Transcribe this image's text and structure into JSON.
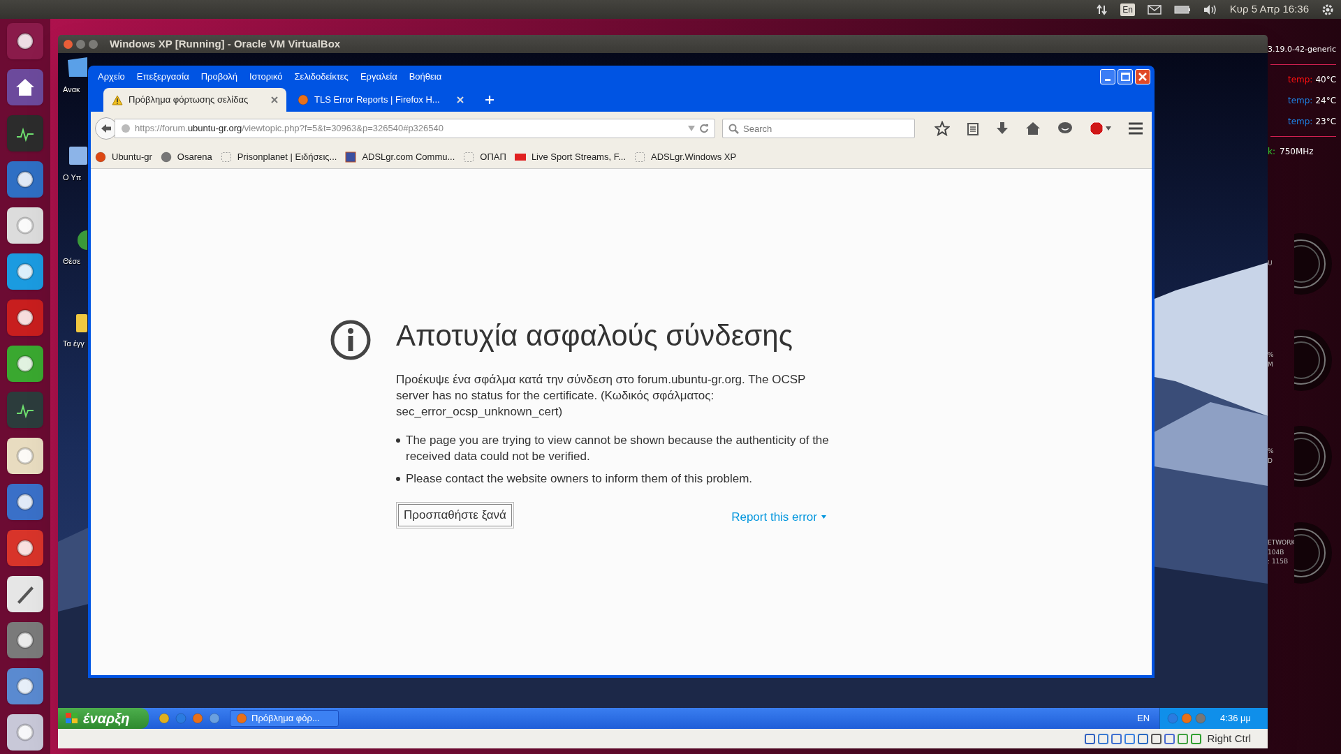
{
  "top_panel": {
    "keyboard": "En",
    "clock": "Κυρ 5 Απρ 16:36"
  },
  "launcher": [
    {
      "kind": "dash"
    },
    {
      "kind": "home"
    },
    {
      "kind": "terminal"
    },
    {
      "kind": "firefox"
    },
    {
      "kind": "chrome"
    },
    {
      "kind": "skype"
    },
    {
      "kind": "reader"
    },
    {
      "kind": "gear"
    },
    {
      "kind": "monitor"
    },
    {
      "kind": "popcorn"
    },
    {
      "kind": "globe"
    },
    {
      "kind": "store"
    },
    {
      "kind": "editor"
    },
    {
      "kind": "installer"
    },
    {
      "kind": "cube"
    },
    {
      "kind": "workspace"
    }
  ],
  "vbox": {
    "title": "Windows XP [Running] - Oracle VM VirtualBox",
    "host_key": "Right Ctrl"
  },
  "desktop_icons": [
    {
      "kind": "bin",
      "label": "Ανακ"
    },
    {
      "kind": "computer",
      "label": "Ο Υπ"
    },
    {
      "kind": "globe",
      "label": "Θέσε"
    },
    {
      "kind": "folder",
      "label": "Τα έγγ"
    }
  ],
  "firefox": {
    "menu": [
      "Αρχείο",
      "Επεξεργασία",
      "Προβολή",
      "Ιστορικό",
      "Σελιδοδείκτες",
      "Εργαλεία",
      "Βοήθεια"
    ],
    "tabs": [
      {
        "kind": "warning",
        "label": "Πρόβλημα φόρτωσης σελίδας",
        "selected": true
      },
      {
        "kind": "firefox",
        "label": "TLS Error Reports | Firefox H...",
        "selected": false
      }
    ],
    "url": {
      "scheme": "https://forum.",
      "domain": "ubuntu-gr.org",
      "path": "/viewtopic.php?f=5&t=30963&p=326540#p326540"
    },
    "search": {
      "placeholder": "Search"
    },
    "bookmarks": [
      {
        "kind": "ubuntu",
        "label": "Ubuntu-gr"
      },
      {
        "kind": "swirl",
        "label": "Osarena"
      },
      {
        "kind": "blank",
        "label": "Prisonplanet | Ειδήσεις..."
      },
      {
        "kind": "grid",
        "label": "ADSLgr.com Commu..."
      },
      {
        "kind": "blank",
        "label": "ΟΠΑΠ"
      },
      {
        "kind": "live",
        "label": "Live Sport Streams, F..."
      },
      {
        "kind": "blank",
        "label": "ADSLgr.Windows XP"
      }
    ],
    "error": {
      "title": "Αποτυχία ασφαλούς σύνδεσης",
      "description": "Προέκυψε ένα σφάλμα κατά την σύνδεση στο forum.ubuntu-gr.org. The OCSP server has no status for the certificate. (Κωδικός σφάλματος: sec_error_ocsp_unknown_cert)",
      "bullets": [
        "The page you are trying to view cannot be shown because the authenticity of the received data could not be verified.",
        "Please contact the website owners to inform them of this problem."
      ],
      "button": "Προσπαθήστε ξανά",
      "report": "Report this error"
    }
  },
  "xp_taskbar": {
    "start": "έναρξη",
    "quick_launch": [
      {
        "kind": "chrome"
      },
      {
        "kind": "ie"
      },
      {
        "kind": "firefox"
      },
      {
        "kind": "desktop"
      }
    ],
    "tasks": [
      {
        "label": "Πρόβλημα φόρ...",
        "selected": false
      }
    ],
    "language": "EN",
    "clock": "4:36 μμ"
  },
  "conky": {
    "kernel": "3.19.0-42-generic",
    "temps": [
      {
        "label": "temp:",
        "value": "40°C",
        "color": "#ff1010"
      },
      {
        "label": "temp:",
        "value": "24°C",
        "color": "#1e7fe0"
      },
      {
        "label": "temp:",
        "value": "23°C",
        "color": "#1e7fe0"
      }
    ],
    "freq": {
      "label": "k:",
      "value": "750MHz"
    },
    "gauges": [
      {
        "labels": [
          "U"
        ]
      },
      {
        "labels": [
          "%",
          "M"
        ]
      },
      {
        "labels": [
          "%",
          "D"
        ]
      },
      {
        "labels": [
          "ETWORK",
          "104B",
          ": 115B"
        ]
      }
    ]
  }
}
